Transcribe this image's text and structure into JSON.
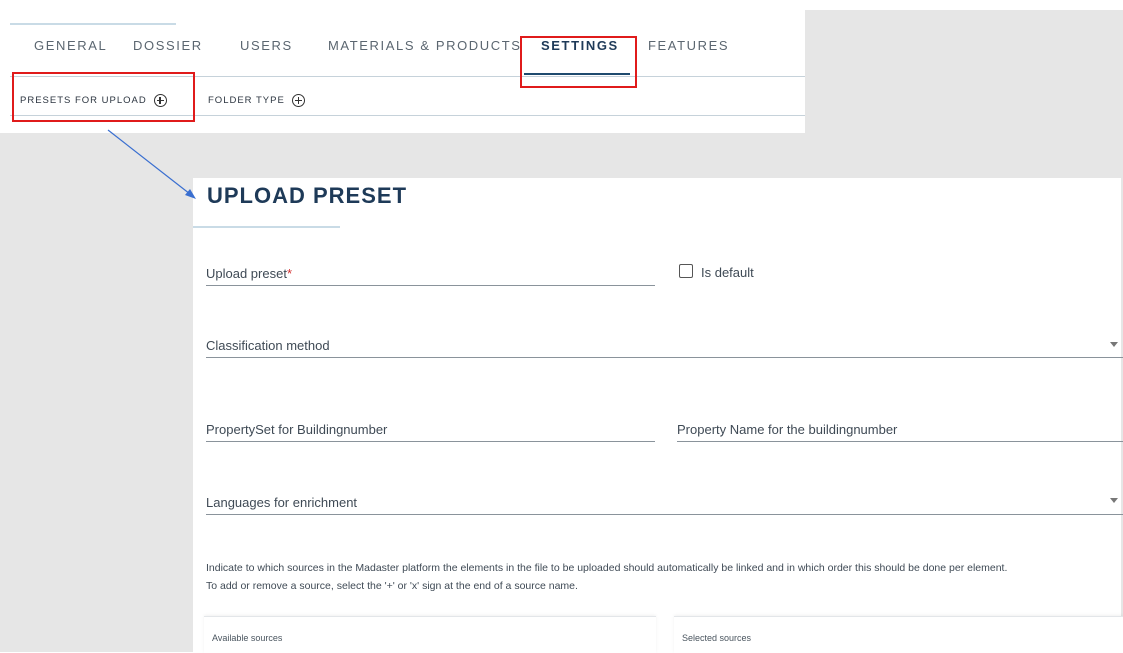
{
  "tabs": {
    "items": [
      {
        "label": "GENERAL",
        "active": false
      },
      {
        "label": "DOSSIER",
        "active": false
      },
      {
        "label": "USERS",
        "active": false
      },
      {
        "label": "MATERIALS & PRODUCTS",
        "active": false
      },
      {
        "label": "SETTINGS",
        "active": true
      },
      {
        "label": "FEATURES",
        "active": false
      }
    ]
  },
  "subtabs": {
    "items": [
      {
        "label": "PRESETS FOR UPLOAD",
        "icon": "plus-circle-icon"
      },
      {
        "label": "FOLDER TYPE",
        "icon": "plus-circle-icon"
      }
    ]
  },
  "form": {
    "title": "UPLOAD PRESET",
    "upload_preset_label": "Upload preset",
    "required_marker": "*",
    "is_default_label": "Is default",
    "is_default_checked": false,
    "classification_label": "Classification method",
    "propertyset_label": "PropertySet for Buildingnumber",
    "property_name_label": "Property Name for the buildingnumber",
    "languages_label": "Languages for enrichment",
    "help_line1": "Indicate to which sources in the Madaster platform the elements in the file to be uploaded should automatically be linked and in which order this should be done per element.",
    "help_line2": "To add or remove a source, select the '+' or 'x' sign at the end of a source name.",
    "available_sources_label": "Available sources",
    "selected_sources_label": "Selected sources"
  },
  "colors": {
    "accent": "#1e3a58",
    "highlight": "#e01b1b",
    "arrow": "#3a6fd0",
    "backdrop": "#e6e6e6"
  }
}
